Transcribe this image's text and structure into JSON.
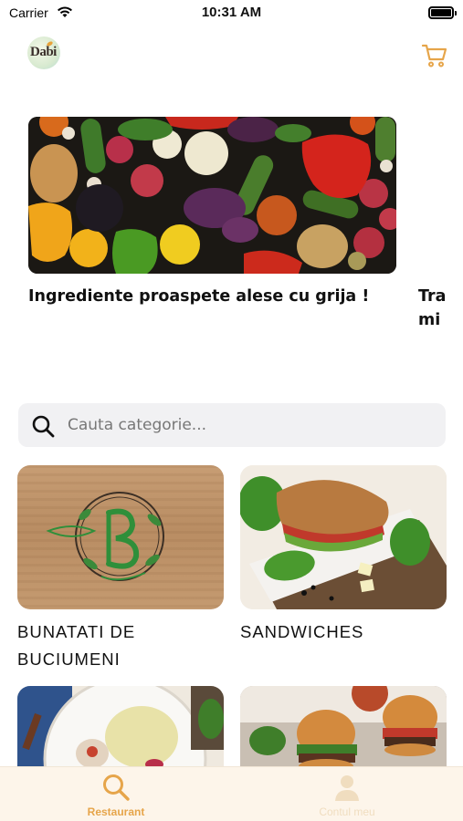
{
  "status_bar": {
    "carrier": "Carrier",
    "time": "10:31 AM"
  },
  "header": {
    "logo_text": "Dabi",
    "cart_icon": "cart-icon",
    "accent_color": "#e6a54a"
  },
  "carousel": {
    "slides": [
      {
        "title": "Ingrediente proaspete alese cu grija !"
      },
      {
        "title": "Tra mi"
      }
    ]
  },
  "search": {
    "placeholder": "Cauta categorie...",
    "value": ""
  },
  "categories": [
    {
      "label": "BUNATATI DE BUCIUMENI"
    },
    {
      "label": "SANDWICHES"
    },
    {
      "label": ""
    },
    {
      "label": ""
    }
  ],
  "tabbar": {
    "items": [
      {
        "label": "Restaurant",
        "icon": "search-icon",
        "active": true
      },
      {
        "label": "Contul meu",
        "icon": "user-icon",
        "active": false
      }
    ]
  }
}
